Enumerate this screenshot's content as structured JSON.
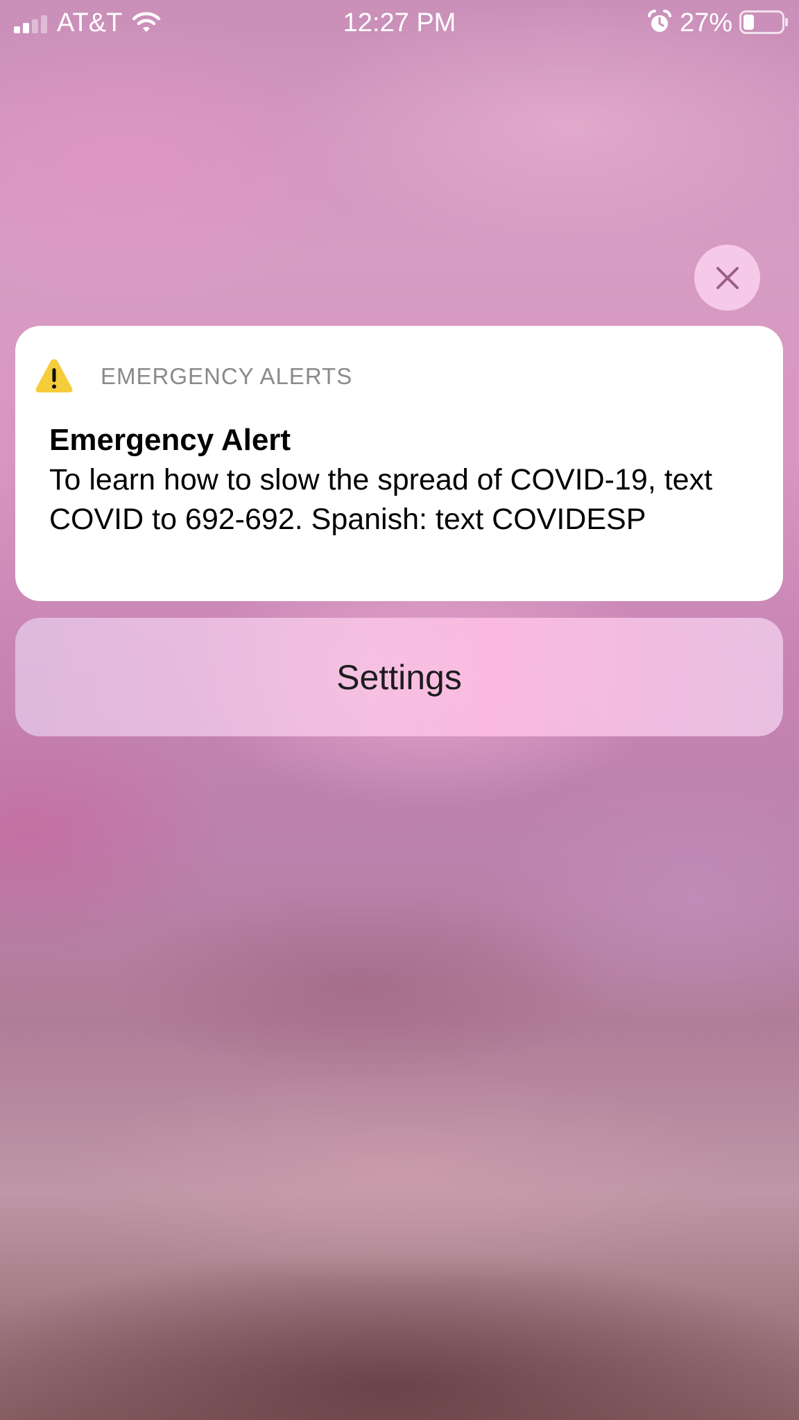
{
  "status_bar": {
    "carrier": "AT&T",
    "time": "12:27 PM",
    "battery_percent": "27%",
    "battery_level": 0.27,
    "signal_bars": 2,
    "signal_bars_total": 4,
    "icons": [
      "signal-icon",
      "wifi-icon",
      "alarm-icon",
      "battery-icon"
    ]
  },
  "alert": {
    "app_name": "EMERGENCY ALERTS",
    "title": "Emergency Alert",
    "body": "To learn how to slow the spread of COVID-19, text COVID to 692-692. Spanish: text COVIDESP",
    "icon": "warning-icon",
    "icon_color": "#f5cc3a"
  },
  "actions": {
    "settings_label": "Settings",
    "close_icon": "close-icon"
  },
  "colors": {
    "close_glyph": "#9a5f88",
    "card_background": "#ffffff",
    "secondary_text": "#8a8a8e"
  }
}
